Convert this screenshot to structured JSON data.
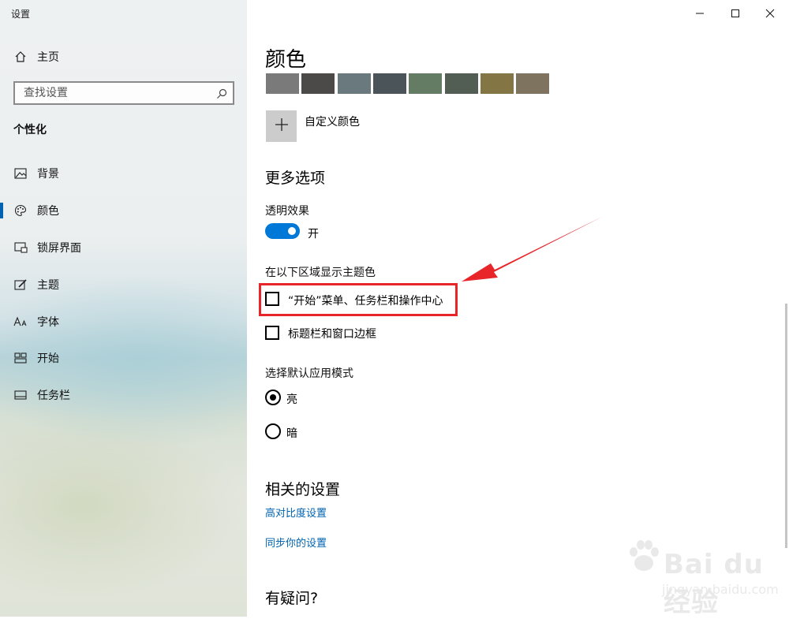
{
  "window": {
    "title": "设置"
  },
  "sidebar": {
    "home_label": "主页",
    "search_placeholder": "查找设置",
    "section_title": "个性化",
    "items": [
      {
        "label": "背景",
        "icon": "image-icon"
      },
      {
        "label": "颜色",
        "icon": "palette-icon",
        "active": true
      },
      {
        "label": "锁屏界面",
        "icon": "lock-screen-icon"
      },
      {
        "label": "主题",
        "icon": "theme-icon"
      },
      {
        "label": "字体",
        "icon": "font-icon"
      },
      {
        "label": "开始",
        "icon": "start-icon"
      },
      {
        "label": "任务栏",
        "icon": "taskbar-icon"
      }
    ]
  },
  "main": {
    "title": "颜色",
    "swatches": [
      "#7a7a7a",
      "#4c4a48",
      "#69797e",
      "#4a5459",
      "#647c64",
      "#525e54",
      "#847545",
      "#7e735f"
    ],
    "custom_color_label": "自定义颜色",
    "more_options_title": "更多选项",
    "transparency_label": "透明效果",
    "transparency_state": "开",
    "accent_surfaces_label": "在以下区域显示主题色",
    "checkbox_start": "“开始”菜单、任务栏和操作中心",
    "checkbox_titlebar": "标题栏和窗口边框",
    "app_mode_label": "选择默认应用模式",
    "radio_light": "亮",
    "radio_dark": "暗",
    "related_title": "相关的设置",
    "link_contrast": "高对比度设置",
    "link_sync": "同步你的设置",
    "question_title": "有疑问?"
  },
  "watermark": {
    "text": "Bai du 经验",
    "sub": "jingyan.baidu.com"
  },
  "colors": {
    "accent": "#0078d7",
    "link": "#0063b1",
    "highlight": "#e8262a"
  }
}
